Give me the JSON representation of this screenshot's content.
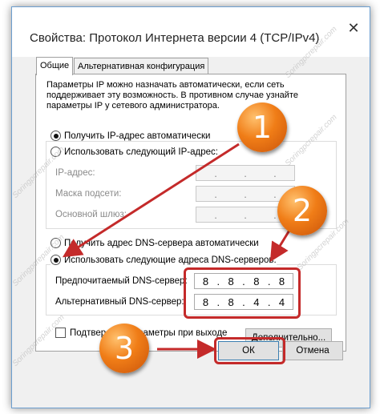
{
  "window": {
    "title": "Свойства: Протокол Интернета версии 4 (TCP/IPv4)",
    "close_glyph": "✕"
  },
  "tabs": [
    {
      "label": "Общие",
      "active": true
    },
    {
      "label": "Альтернативная конфигурация",
      "active": false
    }
  ],
  "description": {
    "line1": "Параметры IP можно назначать автоматически, если сеть",
    "line2": "поддерживает эту возможность. В противном случае узнайте",
    "line3": "параметры IP у сетевого администратора."
  },
  "ip": {
    "auto_label": "Получить IP-адрес автоматически",
    "auto_selected": true,
    "manual_label": "Использовать следующий IP-адрес:",
    "address_label": "IP-адрес:",
    "mask_label": "Маска подсети:",
    "gateway_label": "Основной шлюз:"
  },
  "dns": {
    "auto_label": "Получить адрес DNS-сервера автоматически",
    "manual_label": "Использовать следующие адреса DNS-серверов:",
    "manual_selected": true,
    "preferred_label": "Предпочитаемый DNS-сервер:",
    "preferred": [
      "8",
      "8",
      "8",
      "8"
    ],
    "alternate_label": "Альтернативный DNS-сервер:",
    "alternate": [
      "8",
      "8",
      "4",
      "4"
    ]
  },
  "validate_label": "Подтвердить параметры при выходе",
  "buttons": {
    "advanced": "Дополнительно...",
    "ok": "ОК",
    "cancel": "Отмена"
  },
  "annotations": {
    "step1": "1",
    "step2": "2",
    "step3": "3",
    "color": "#c42a2a"
  },
  "watermark": "Soringpcrepair.com"
}
